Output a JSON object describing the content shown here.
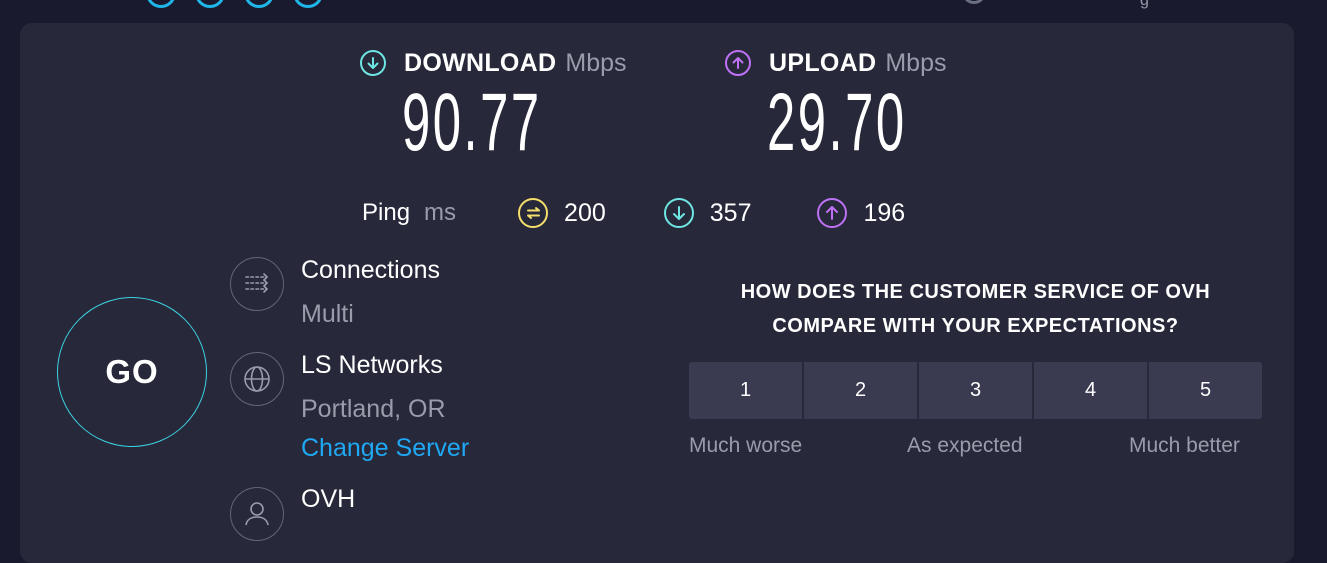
{
  "header": {
    "partial_text": "g"
  },
  "download": {
    "label": "DOWNLOAD",
    "unit": "Mbps",
    "value": "90.77"
  },
  "upload": {
    "label": "UPLOAD",
    "unit": "Mbps",
    "value": "29.70"
  },
  "ping": {
    "label": "Ping",
    "unit": "ms",
    "idle": "200",
    "download": "357",
    "upload": "196"
  },
  "go_button": {
    "label": "GO"
  },
  "connections": {
    "title": "Connections",
    "value": "Multi"
  },
  "server": {
    "name": "LS Networks",
    "location": "Portland, OR",
    "change_link": "Change Server"
  },
  "provider": {
    "name": "OVH"
  },
  "survey": {
    "question_line1": "HOW DOES THE CUSTOMER SERVICE OF OVH",
    "question_line2": "COMPARE WITH YOUR EXPECTATIONS?",
    "options": [
      "1",
      "2",
      "3",
      "4",
      "5"
    ],
    "scale_low": "Much worse",
    "scale_mid": "As expected",
    "scale_high": "Much better"
  },
  "colors": {
    "background": "#1a1a2e",
    "panel": "#272839",
    "download_accent": "#6fe6e3",
    "upload_accent": "#bf71f5",
    "ping_accent": "#f4de6c",
    "go_ring": "#3ad3e4",
    "link": "#1fa8f3"
  },
  "icons": {
    "download": "arrow-down-circle-icon",
    "upload": "arrow-up-circle-icon",
    "idle_ping": "idle-latency-icon",
    "connections": "connections-icon",
    "server": "globe-icon",
    "provider": "person-icon"
  }
}
